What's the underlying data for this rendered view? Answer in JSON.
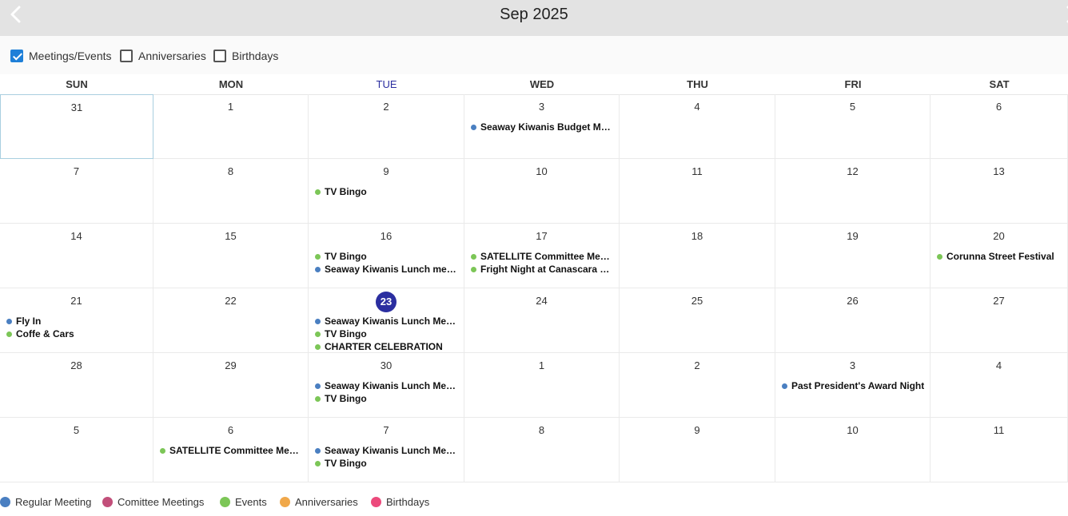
{
  "header": {
    "title": "Sep 2025"
  },
  "filters": [
    {
      "label": "Meetings/Events",
      "checked": true
    },
    {
      "label": "Anniversaries",
      "checked": false
    },
    {
      "label": "Birthdays",
      "checked": false
    }
  ],
  "weekdays": [
    "SUN",
    "MON",
    "TUE",
    "WED",
    "THU",
    "FRI",
    "SAT"
  ],
  "today_weekday_index": 2,
  "colors": {
    "regular": "#4a7fc1",
    "committee": "#c24f7a",
    "event": "#7cc657",
    "anniversary": "#f0a84a",
    "birthday": "#ec4a7c",
    "accent": "#2b2ea0"
  },
  "weeks": [
    [
      {
        "day": "31",
        "selected": true,
        "events": []
      },
      {
        "day": "1",
        "events": []
      },
      {
        "day": "2",
        "events": []
      },
      {
        "day": "3",
        "events": [
          {
            "text": "Seaway Kiwanis Budget Meeting",
            "type": "regular"
          }
        ]
      },
      {
        "day": "4",
        "events": []
      },
      {
        "day": "5",
        "events": []
      },
      {
        "day": "6",
        "events": []
      }
    ],
    [
      {
        "day": "7",
        "events": []
      },
      {
        "day": "8",
        "events": []
      },
      {
        "day": "9",
        "events": [
          {
            "text": "TV Bingo",
            "type": "event"
          }
        ]
      },
      {
        "day": "10",
        "events": []
      },
      {
        "day": "11",
        "events": []
      },
      {
        "day": "12",
        "events": []
      },
      {
        "day": "13",
        "events": []
      }
    ],
    [
      {
        "day": "14",
        "events": []
      },
      {
        "day": "15",
        "events": []
      },
      {
        "day": "16",
        "events": [
          {
            "text": "TV Bingo",
            "type": "event"
          },
          {
            "text": "Seaway Kiwanis Lunch meeting",
            "type": "regular"
          }
        ]
      },
      {
        "day": "17",
        "events": [
          {
            "text": "SATELLITE Committee Meeting",
            "type": "event"
          },
          {
            "text": "Fright Night at Canascara Meeting",
            "type": "event"
          }
        ]
      },
      {
        "day": "18",
        "events": []
      },
      {
        "day": "19",
        "events": []
      },
      {
        "day": "20",
        "events": [
          {
            "text": "Corunna Street Festival",
            "type": "event"
          }
        ]
      }
    ],
    [
      {
        "day": "21",
        "events": [
          {
            "text": "Fly In",
            "type": "regular"
          },
          {
            "text": "Coffe & Cars",
            "type": "event"
          }
        ]
      },
      {
        "day": "22",
        "events": []
      },
      {
        "day": "23",
        "today": true,
        "events": [
          {
            "text": "Seaway Kiwanis Lunch Meeting",
            "type": "regular"
          },
          {
            "text": "TV Bingo",
            "type": "event"
          },
          {
            "text": "CHARTER CELEBRATION",
            "type": "event"
          }
        ]
      },
      {
        "day": "24",
        "events": []
      },
      {
        "day": "25",
        "events": []
      },
      {
        "day": "26",
        "events": []
      },
      {
        "day": "27",
        "events": []
      }
    ],
    [
      {
        "day": "28",
        "events": []
      },
      {
        "day": "29",
        "events": []
      },
      {
        "day": "30",
        "events": [
          {
            "text": "Seaway Kiwanis Lunch Meeting",
            "type": "regular"
          },
          {
            "text": "TV Bingo",
            "type": "event"
          }
        ]
      },
      {
        "day": "1",
        "events": []
      },
      {
        "day": "2",
        "events": []
      },
      {
        "day": "3",
        "events": [
          {
            "text": "Past President's Award Night",
            "type": "regular"
          }
        ]
      },
      {
        "day": "4",
        "events": []
      }
    ],
    [
      {
        "day": "5",
        "events": []
      },
      {
        "day": "6",
        "events": [
          {
            "text": "SATELLITE Committee Meeting",
            "type": "event"
          }
        ]
      },
      {
        "day": "7",
        "events": [
          {
            "text": "Seaway Kiwanis Lunch Meeting",
            "type": "regular"
          },
          {
            "text": "TV Bingo",
            "type": "event"
          }
        ]
      },
      {
        "day": "8",
        "events": []
      },
      {
        "day": "9",
        "events": []
      },
      {
        "day": "10",
        "events": []
      },
      {
        "day": "11",
        "events": []
      }
    ]
  ],
  "legend": [
    {
      "label": "Regular Meeting",
      "type": "regular"
    },
    {
      "label": "Comittee Meetings",
      "type": "committee"
    },
    {
      "label": "Events",
      "type": "event"
    },
    {
      "label": "Anniversaries",
      "type": "anniversary"
    },
    {
      "label": "Birthdays",
      "type": "birthday"
    }
  ]
}
